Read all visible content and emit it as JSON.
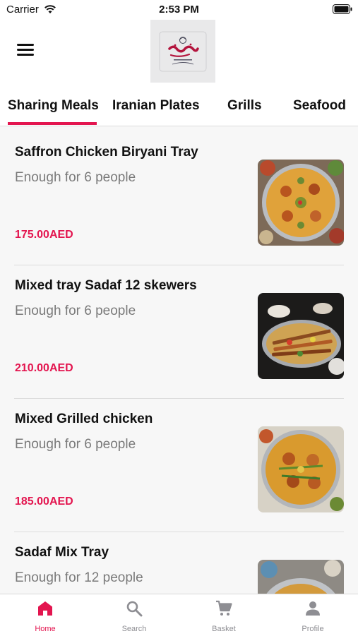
{
  "status_bar": {
    "carrier": "Carrier",
    "time": "2:53 PM"
  },
  "header": {
    "logo_icon": "sadaf-restaurant-logo",
    "menu_icon": "menu-icon"
  },
  "tabs": [
    {
      "label": "Sharing Meals",
      "active": true
    },
    {
      "label": "Iranian Plates"
    },
    {
      "label": "Grills"
    },
    {
      "label": "Seafood"
    }
  ],
  "items": [
    {
      "title": "Saffron Chicken Biryani Tray",
      "description": "Enough for 6 people",
      "price": "175.00AED"
    },
    {
      "title": "Mixed tray Sadaf 12 skewers",
      "description": "Enough for 6 people",
      "price": "210.00AED"
    },
    {
      "title": "Mixed Grilled chicken",
      "description": "Enough for 6 people",
      "price": "185.00AED"
    },
    {
      "title": "Sadaf Mix Tray",
      "description": "Enough for 12 people",
      "price": ""
    }
  ],
  "bottom_nav": [
    {
      "label": "Home",
      "icon": "home-icon",
      "active": true
    },
    {
      "label": "Search",
      "icon": "search-icon"
    },
    {
      "label": "Basket",
      "icon": "cart-icon"
    },
    {
      "label": "Profile",
      "icon": "profile-icon"
    }
  ],
  "colors": {
    "accent": "#e3154f",
    "muted": "#7a7a7a",
    "background": "#f7f7f7"
  }
}
